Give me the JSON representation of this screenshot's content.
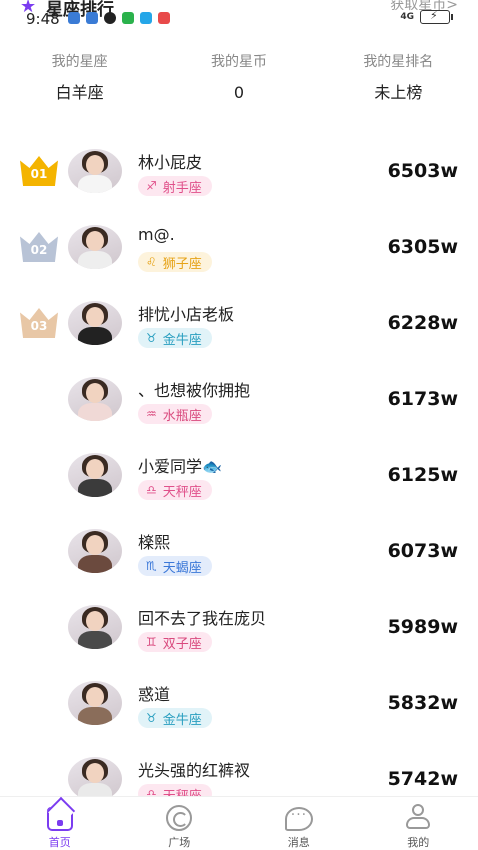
{
  "header": {
    "title": "星座排行",
    "title_icon": "star-icon",
    "action": "获取星币>",
    "status_time": "9:48",
    "network": "4G"
  },
  "my_stats": [
    {
      "label": "我的星座",
      "value": "白羊座"
    },
    {
      "label": "我的星币",
      "value": "0"
    },
    {
      "label": "我的星排名",
      "value": "未上榜"
    }
  ],
  "colors": {
    "accent": "#7b3cf0",
    "gold": "#f4b400",
    "silver": "#b8c3d6",
    "bronze": "#e8c7a6"
  },
  "rankings": [
    {
      "rank": "01",
      "name": "林小屁皮",
      "sign": "射手座",
      "sign_glyph": "♐",
      "score": "6503w",
      "tag_bg": "#fde7f0",
      "tag_fg": "#e0508a",
      "body": "#f5f5f5"
    },
    {
      "rank": "02",
      "name": "m@.",
      "sign": "狮子座",
      "sign_glyph": "♌",
      "score": "6305w",
      "tag_bg": "#fdf3dc",
      "tag_fg": "#e6a318",
      "body": "#eeeeee"
    },
    {
      "rank": "03",
      "name": "排忧小店老板",
      "sign": "金牛座",
      "sign_glyph": "♉",
      "score": "6228w",
      "tag_bg": "#e1f3f8",
      "tag_fg": "#2a9fc0",
      "body": "#222222"
    },
    {
      "rank": "",
      "name": "、也想被你拥抱",
      "sign": "水瓶座",
      "sign_glyph": "♒",
      "score": "6173w",
      "tag_bg": "#fde7f0",
      "tag_fg": "#d94a7e",
      "body": "#f0d9d6"
    },
    {
      "rank": "",
      "name": "小爱同学🐟",
      "sign": "天秤座",
      "sign_glyph": "♎",
      "score": "6125w",
      "tag_bg": "#fde7f0",
      "tag_fg": "#e0508a",
      "body": "#3b3b3b"
    },
    {
      "rank": "",
      "name": "檪熙",
      "sign": "天蝎座",
      "sign_glyph": "♏",
      "score": "6073w",
      "tag_bg": "#e3ecfb",
      "tag_fg": "#3b78d8",
      "body": "#6b4a3e"
    },
    {
      "rank": "",
      "name": "回不去了我在庞贝",
      "sign": "双子座",
      "sign_glyph": "♊",
      "score": "5989w",
      "tag_bg": "#fde7f0",
      "tag_fg": "#d94a7e",
      "body": "#4a4a4a"
    },
    {
      "rank": "",
      "name": "惑道",
      "sign": "金牛座",
      "sign_glyph": "♉",
      "score": "5832w",
      "tag_bg": "#e1f3f8",
      "tag_fg": "#2a9fc0",
      "body": "#8a6d5a"
    },
    {
      "rank": "",
      "name": "光头强的红裤衩",
      "sign": "天秤座",
      "sign_glyph": "♎",
      "score": "5742w",
      "tag_bg": "#fde7f0",
      "tag_fg": "#e0508a",
      "body": "#eaeaea"
    }
  ],
  "nav": [
    {
      "label": "首页",
      "icon": "home-icon",
      "active": true
    },
    {
      "label": "广场",
      "icon": "plaza-icon",
      "active": false
    },
    {
      "label": "消息",
      "icon": "message-icon",
      "active": false
    },
    {
      "label": "我的",
      "icon": "profile-icon",
      "active": false
    }
  ]
}
